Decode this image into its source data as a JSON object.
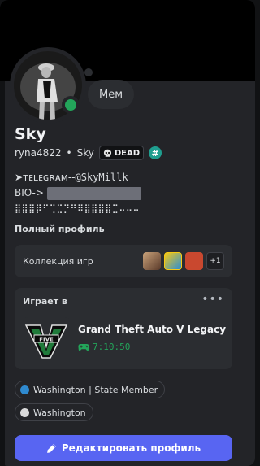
{
  "profile": {
    "status_bubble": "Мем",
    "display_name": "Sky",
    "username": "ryna4822",
    "server_tag": "Sky",
    "badge_text": "DEAD",
    "badge_icon": "skull-icon",
    "hash_icon": "#"
  },
  "bio": {
    "line1_prefix": "➤ᴛᴇʟᴇɢʀᴀᴍ--",
    "line1_handle": "@SkyMillk",
    "line2_prefix": "BIO->",
    "line3": "⣿⣿⣿⡿⠋⢉⣉⡙⠛⠿⣿⣿⣿⣿⣉⠤⠤⠤"
  },
  "sections": {
    "full_profile": "Полный профиль",
    "games_collection": "Коллекция игр",
    "games_more": "+1"
  },
  "activity": {
    "header": "Играет в",
    "more": "•••",
    "game_name": "Grand Theft Auto V Legacy",
    "elapsed": "7:10:50",
    "time_icon": "gamepad-icon"
  },
  "roles": [
    {
      "label": "Washington | State Member",
      "color": "#2f8ad0"
    },
    {
      "label": "Washington",
      "color": "#d9d9d9"
    }
  ],
  "actions": {
    "edit_profile": "Редактировать профиль"
  },
  "colors": {
    "accent": "#5865f2",
    "online": "#23a55a",
    "panel": "#2b2d31",
    "background": "#232428"
  }
}
